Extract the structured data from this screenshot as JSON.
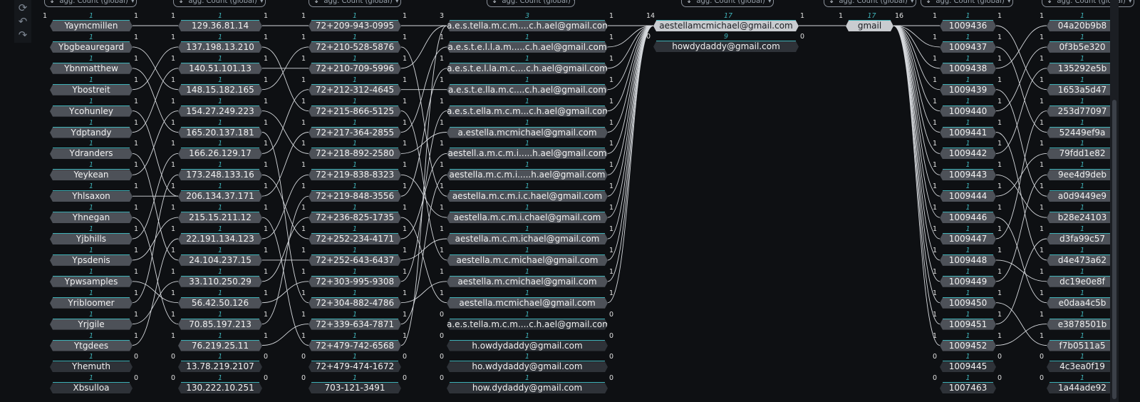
{
  "toolbar": {
    "icons": [
      "refresh-icon",
      "undo-icon",
      "redo-icon"
    ],
    "glyphs": [
      "⟳",
      "↶",
      "↷"
    ]
  },
  "columns": [
    {
      "header": "agg. Count (global)",
      "top_counts": {
        "left": "1",
        "mid": "1",
        "right": "1"
      },
      "nodes": [
        {
          "label": "Yaymcmillen",
          "l": "",
          "m": "",
          "r": ""
        },
        {
          "label": "Ybgbeauregard",
          "l": "",
          "m": "1",
          "r": "1"
        },
        {
          "label": "Ybnmatthew",
          "l": "",
          "m": "1",
          "r": "1"
        },
        {
          "label": "Ybostreit",
          "l": "",
          "m": "1",
          "r": "1"
        },
        {
          "label": "Ycohunley",
          "l": "",
          "m": "1",
          "r": "1"
        },
        {
          "label": "Ydptandy",
          "l": "",
          "m": "1",
          "r": "1"
        },
        {
          "label": "Ydranders",
          "l": "",
          "m": "1",
          "r": "1"
        },
        {
          "label": "Yeykean",
          "l": "",
          "m": "1",
          "r": "1"
        },
        {
          "label": "Yhlsaxon",
          "l": "",
          "m": "1",
          "r": "1"
        },
        {
          "label": "Yhnegan",
          "l": "",
          "m": "1",
          "r": "1"
        },
        {
          "label": "Yjbhills",
          "l": "",
          "m": "1",
          "r": "1"
        },
        {
          "label": "Ypsdenis",
          "l": "",
          "m": "1",
          "r": "1"
        },
        {
          "label": "Ypwsamples",
          "l": "",
          "m": "1",
          "r": "1"
        },
        {
          "label": "Yribloomer",
          "l": "",
          "m": "1",
          "r": "1"
        },
        {
          "label": "Yrjgile",
          "l": "",
          "m": "1",
          "r": "1"
        },
        {
          "label": "Ytgdees",
          "l": "",
          "m": "1",
          "r": "1"
        },
        {
          "label": "Yhemuth",
          "l": "",
          "m": "1",
          "r": "0"
        },
        {
          "label": "Xbsulloa",
          "l": "",
          "m": "1",
          "r": "0"
        }
      ]
    },
    {
      "header": "agg. Count (global)",
      "top_counts": {
        "left": "1",
        "mid": "1",
        "right": "1"
      },
      "nodes": [
        {
          "label": "129.36.81.14",
          "l": "1",
          "m": "1",
          "r": "1"
        },
        {
          "label": "137.198.13.210",
          "l": "1",
          "m": "1",
          "r": "1"
        },
        {
          "label": "140.51.101.13",
          "l": "1",
          "m": "1",
          "r": "1"
        },
        {
          "label": "148.15.182.165",
          "l": "1",
          "m": "1",
          "r": "1"
        },
        {
          "label": "154.27.249.223",
          "l": "1",
          "m": "1",
          "r": "1"
        },
        {
          "label": "165.20.137.181",
          "l": "1",
          "m": "1",
          "r": "1"
        },
        {
          "label": "166.26.129.17",
          "l": "1",
          "m": "1",
          "r": "1"
        },
        {
          "label": "173.248.133.16",
          "l": "1",
          "m": "1",
          "r": "1"
        },
        {
          "label": "206.134.37.171",
          "l": "1",
          "m": "1",
          "r": "1"
        },
        {
          "label": "215.15.211.12",
          "l": "1",
          "m": "1",
          "r": "1"
        },
        {
          "label": "22.191.134.123",
          "l": "1",
          "m": "1",
          "r": "1"
        },
        {
          "label": "24.104.237.15",
          "l": "1",
          "m": "1",
          "r": "1"
        },
        {
          "label": "33.110.250.29",
          "l": "1",
          "m": "1",
          "r": "1"
        },
        {
          "label": "56.42.50.126",
          "l": "1",
          "m": "1",
          "r": "1"
        },
        {
          "label": "70.85.197.213",
          "l": "1",
          "m": "1",
          "r": "1"
        },
        {
          "label": "76.219.25.11",
          "l": "1",
          "m": "1",
          "r": "1"
        },
        {
          "label": "13.78.219.2107",
          "l": "0",
          "m": "1",
          "r": "0"
        },
        {
          "label": "130.222.10.251",
          "l": "0",
          "m": "1",
          "r": "0"
        }
      ]
    },
    {
      "header": "agg. Count (global)",
      "top_counts": {
        "left": "1",
        "mid": "1",
        "right": "1"
      },
      "nodes": [
        {
          "label": "72+209-943-0995",
          "l": "1",
          "m": "1",
          "r": "1"
        },
        {
          "label": "72+210-528-5876",
          "l": "1",
          "m": "1",
          "r": "1"
        },
        {
          "label": "72+210-709-5996",
          "l": "1",
          "m": "1",
          "r": "1"
        },
        {
          "label": "72+212-312-4645",
          "l": "1",
          "m": "1",
          "r": "1"
        },
        {
          "label": "72+215-866-5125",
          "l": "1",
          "m": "1",
          "r": "1"
        },
        {
          "label": "72+217-364-2855",
          "l": "1",
          "m": "1",
          "r": "1"
        },
        {
          "label": "72+218-892-2580",
          "l": "1",
          "m": "1",
          "r": "1"
        },
        {
          "label": "72+219-838-8323",
          "l": "1",
          "m": "1",
          "r": "1"
        },
        {
          "label": "72+219-848-3556",
          "l": "1",
          "m": "1",
          "r": "1"
        },
        {
          "label": "72+236-825-1735",
          "l": "1",
          "m": "1",
          "r": "1"
        },
        {
          "label": "72+252-234-4171",
          "l": "1",
          "m": "1",
          "r": "1"
        },
        {
          "label": "72+252-643-6437",
          "l": "1",
          "m": "1",
          "r": "1"
        },
        {
          "label": "72+303-995-9308",
          "l": "1",
          "m": "1",
          "r": "1"
        },
        {
          "label": "72+304-882-4786",
          "l": "1",
          "m": "1",
          "r": "1"
        },
        {
          "label": "72+339-634-7871",
          "l": "1",
          "m": "1",
          "r": "1"
        },
        {
          "label": "72+479-742-6568",
          "l": "1",
          "m": "1",
          "r": "1"
        },
        {
          "label": "72+479-474-1672",
          "l": "0",
          "m": "1",
          "r": "0"
        },
        {
          "label": "703-121-3491",
          "l": "0",
          "m": "1",
          "r": "0"
        }
      ]
    },
    {
      "header": "agg. Count (global)",
      "top_counts": {
        "left": "3",
        "mid": "3",
        "right": "1"
      },
      "nodes": [
        {
          "label": "a.e.s.tella.m.c.m....c.h.ael@gmail.com",
          "l": "3",
          "m": "3",
          "r": "1"
        },
        {
          "label": "a.e.s.t.e.l.l.a.m.....c.h.ael@gmail.com",
          "l": "1",
          "m": "1",
          "r": "1"
        },
        {
          "label": "a.e.s.t.e.l.la.m.c....c.h.ael@gmail.com",
          "l": "1",
          "m": "1",
          "r": "1"
        },
        {
          "label": "a.e.s.t.e.lla.m.c....c.h.ael@gmail.com",
          "l": "1",
          "m": "1",
          "r": "1"
        },
        {
          "label": "a.e.s.t.ella.m.c.m...c.h.ael@gmail.com",
          "l": "1",
          "m": "1",
          "r": "1"
        },
        {
          "label": "a.estella.mcmichael@gmail.com",
          "l": "1",
          "m": "1",
          "r": "1"
        },
        {
          "label": "aestell.a.m.c.m.i.....h.ael@gmail.com",
          "l": "1",
          "m": "1",
          "r": "1"
        },
        {
          "label": "aestella.m.c.m.i.....h.ael@gmail.com",
          "l": "1",
          "m": "1",
          "r": "1"
        },
        {
          "label": "aestella.m.c.m.i.c.hael@gmail.com",
          "l": "1",
          "m": "1",
          "r": "1"
        },
        {
          "label": "aestella.m.c.m.i.chael@gmail.com",
          "l": "1",
          "m": "1",
          "r": "1"
        },
        {
          "label": "aestella.m.c.m.ichael@gmail.com",
          "l": "1",
          "m": "1",
          "r": "1"
        },
        {
          "label": "aestella.m.c.michael@gmail.com",
          "l": "1",
          "m": "1",
          "r": "1"
        },
        {
          "label": "aestella.m.cmichael@gmail.com",
          "l": "1",
          "m": "1",
          "r": "1"
        },
        {
          "label": "aestella.mcmichael@gmail.com",
          "l": "1",
          "m": "1",
          "r": "1"
        },
        {
          "label": "a.e.s.tella.m.c.m....c.h.ael@gmail.com",
          "l": "0",
          "m": "1",
          "r": "0"
        },
        {
          "label": "h.owdydaddy@gmail.com",
          "l": "0",
          "m": "1",
          "r": "0"
        },
        {
          "label": "ho.wdydaddy@gmail.com",
          "l": "0",
          "m": "1",
          "r": "0"
        },
        {
          "label": "how.dydaddy@gmail.com",
          "l": "0",
          "m": "1",
          "r": "0"
        }
      ]
    },
    {
      "header": "agg. Count (global)",
      "top_counts": {
        "left": "14",
        "mid": "17",
        "right": "1"
      },
      "nodes": [
        {
          "label": "aestellamcmichael@gmail.com",
          "l": "",
          "m": "",
          "r": ""
        },
        {
          "label": "howdydaddy@gmail.com",
          "l": "0",
          "m": "9",
          "r": "0"
        }
      ]
    },
    {
      "header": "agg. Count (global)",
      "top_counts": {
        "left": "1",
        "mid": "17",
        "right": "16"
      },
      "nodes": [
        {
          "label": "gmail",
          "l": "",
          "m": "",
          "r": ""
        }
      ]
    },
    {
      "header": "agg. Count (global)",
      "top_counts": {
        "left": "1",
        "mid": "1",
        "right": "1"
      },
      "nodes": [
        {
          "label": "1009436",
          "l": "",
          "m": "",
          "r": ""
        },
        {
          "label": "1009437",
          "l": "1",
          "m": "1",
          "r": "1"
        },
        {
          "label": "1009438",
          "l": "1",
          "m": "1",
          "r": "1"
        },
        {
          "label": "1009439",
          "l": "1",
          "m": "1",
          "r": "1"
        },
        {
          "label": "1009440",
          "l": "1",
          "m": "1",
          "r": "1"
        },
        {
          "label": "1009441",
          "l": "1",
          "m": "1",
          "r": "1"
        },
        {
          "label": "1009442",
          "l": "1",
          "m": "1",
          "r": "1"
        },
        {
          "label": "1009443",
          "l": "1",
          "m": "1",
          "r": "1"
        },
        {
          "label": "1009444",
          "l": "1",
          "m": "1",
          "r": "1"
        },
        {
          "label": "1009446",
          "l": "1",
          "m": "1",
          "r": "1"
        },
        {
          "label": "1009447",
          "l": "1",
          "m": "1",
          "r": "1"
        },
        {
          "label": "1009448",
          "l": "1",
          "m": "1",
          "r": "1"
        },
        {
          "label": "1009449",
          "l": "1",
          "m": "1",
          "r": "1"
        },
        {
          "label": "1009450",
          "l": "1",
          "m": "1",
          "r": "1"
        },
        {
          "label": "1009451",
          "l": "1",
          "m": "1",
          "r": "1"
        },
        {
          "label": "1009452",
          "l": "1",
          "m": "1",
          "r": "1"
        },
        {
          "label": "1009445",
          "l": "0",
          "m": "1",
          "r": "0"
        },
        {
          "label": "1007463",
          "l": "0",
          "m": "1",
          "r": "0"
        }
      ]
    },
    {
      "header": "agg. Count (global)",
      "top_counts": {
        "left": "1",
        "mid": "1",
        "right": ""
      },
      "nodes": [
        {
          "label": "04a20b9b8",
          "l": "",
          "m": "",
          "r": ""
        },
        {
          "label": "0f3b5e320",
          "l": "1",
          "m": "1",
          "r": ""
        },
        {
          "label": "135292e5b",
          "l": "1",
          "m": "1",
          "r": ""
        },
        {
          "label": "1653a5d47",
          "l": "1",
          "m": "1",
          "r": ""
        },
        {
          "label": "253d77097",
          "l": "1",
          "m": "1",
          "r": ""
        },
        {
          "label": "52449ef9a",
          "l": "1",
          "m": "1",
          "r": ""
        },
        {
          "label": "79fdd1e82",
          "l": "1",
          "m": "1",
          "r": ""
        },
        {
          "label": "9ee4d9deb",
          "l": "1",
          "m": "1",
          "r": ""
        },
        {
          "label": "a0d9449e9",
          "l": "1",
          "m": "1",
          "r": ""
        },
        {
          "label": "b28e24103",
          "l": "1",
          "m": "1",
          "r": ""
        },
        {
          "label": "d3fa99c57",
          "l": "1",
          "m": "1",
          "r": ""
        },
        {
          "label": "d4e473a62",
          "l": "1",
          "m": "1",
          "r": ""
        },
        {
          "label": "dc19e0e8f",
          "l": "1",
          "m": "1",
          "r": ""
        },
        {
          "label": "e0daa4c5b",
          "l": "1",
          "m": "1",
          "r": ""
        },
        {
          "label": "e3878501b",
          "l": "1",
          "m": "1",
          "r": ""
        },
        {
          "label": "f7b0511a5",
          "l": "1",
          "m": "1",
          "r": ""
        },
        {
          "label": "4c3ea0f19",
          "l": "0",
          "m": "1",
          "r": ""
        },
        {
          "label": "1a44ade92",
          "l": "0",
          "m": "1",
          "r": ""
        }
      ]
    }
  ]
}
